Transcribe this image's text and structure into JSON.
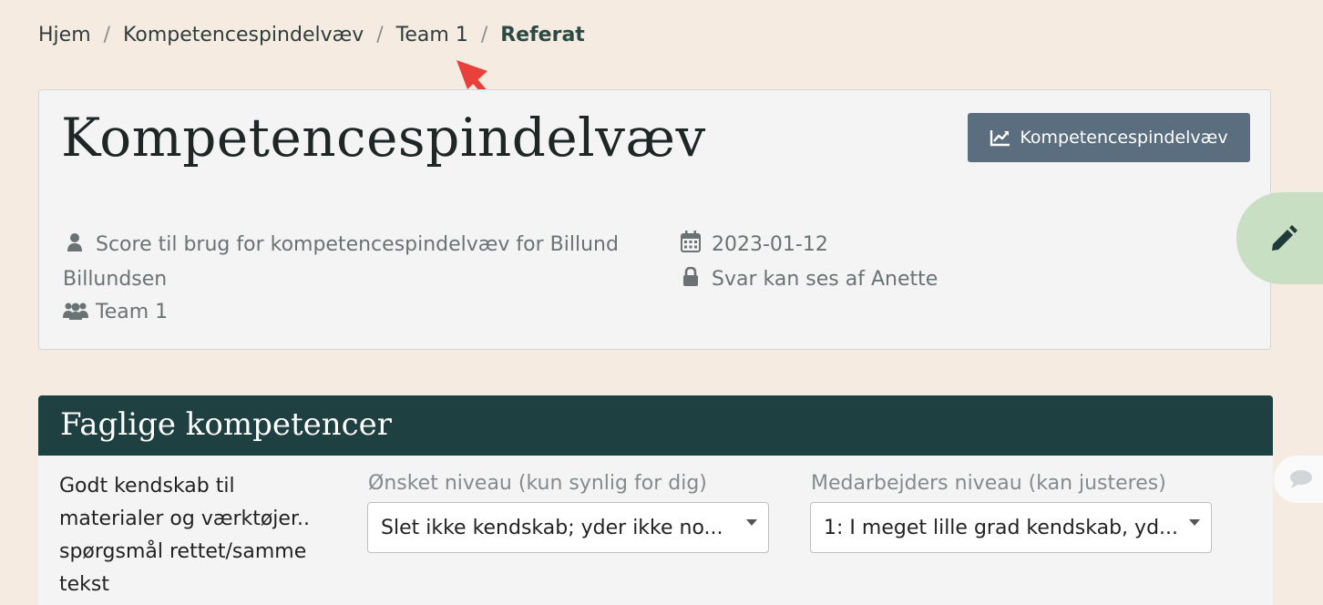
{
  "breadcrumb": {
    "items": [
      "Hjem",
      "Kompetencespindelvæv",
      "Team 1"
    ],
    "separator": "/",
    "current": "Referat"
  },
  "card": {
    "title": "Kompetencespindelvæv",
    "chart_button_label": "Kompetencespindelvæv",
    "meta": {
      "description": "Score til brug for kompetencespindelvæv for Billund Billundsen",
      "team": "Team 1",
      "date": "2023-01-12",
      "visibility": "Svar kan ses af Anette"
    }
  },
  "section": {
    "title": "Faglige kompetencer",
    "question": "Godt kendskab til materialer og værktøjer.. spørgsmål rettet/samme tekst",
    "desired_level": {
      "label": "Ønsket niveau (kun synlig for dig)",
      "value": "Slet ikke kendskab; yder ikke no..."
    },
    "employee_level": {
      "label": "Medarbejders niveau (kan justeres)",
      "value": "1: I meget lille grad kendskab, yd..."
    }
  },
  "icons": {
    "user": "user-icon",
    "users": "users-icon",
    "calendar": "calendar-icon",
    "lock": "lock-icon",
    "chart": "line-chart-icon",
    "edit": "pencil-icon",
    "comment": "comment-icon",
    "annotation": "red-arrow-annotation"
  },
  "colors": {
    "page_bg": "#f5ebe0",
    "button_bg": "#5a6e80",
    "section_header_bg": "#1f4040",
    "edit_fab_bg": "#c9dfc3",
    "annotation_arrow": "#e8403a"
  }
}
